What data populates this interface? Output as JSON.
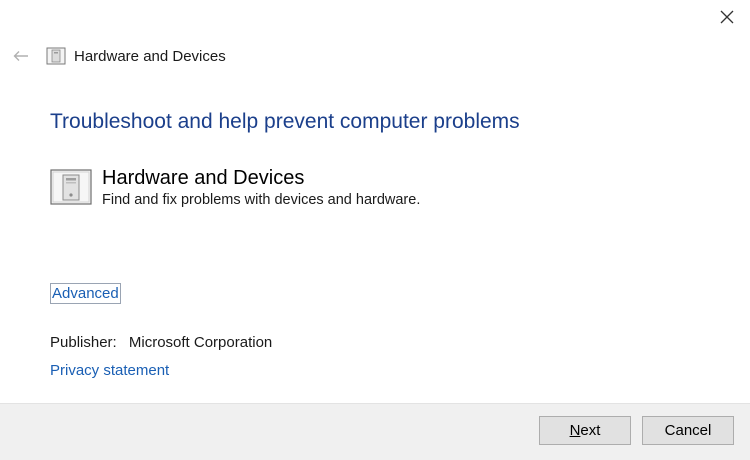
{
  "window": {
    "title": "Hardware and Devices"
  },
  "controls": {
    "back_icon": "back-arrow-icon",
    "close_icon": "close-icon"
  },
  "main": {
    "heading": "Troubleshoot and help prevent computer problems",
    "troubleshooter": {
      "icon": "hardware-devices-icon",
      "title": "Hardware and Devices",
      "description": "Find and fix problems with devices and hardware."
    },
    "advanced_link": "Advanced",
    "publisher_label": "Publisher:",
    "publisher_value": "Microsoft Corporation",
    "privacy_link": "Privacy statement"
  },
  "footer": {
    "next_label_accel": "N",
    "next_label_rest": "ext",
    "cancel_label": "Cancel"
  },
  "colors": {
    "heading": "#1b3f8b",
    "link": "#1a5fb4",
    "footer_bg": "#f0f0f0",
    "button_bg": "#e1e1e1"
  }
}
